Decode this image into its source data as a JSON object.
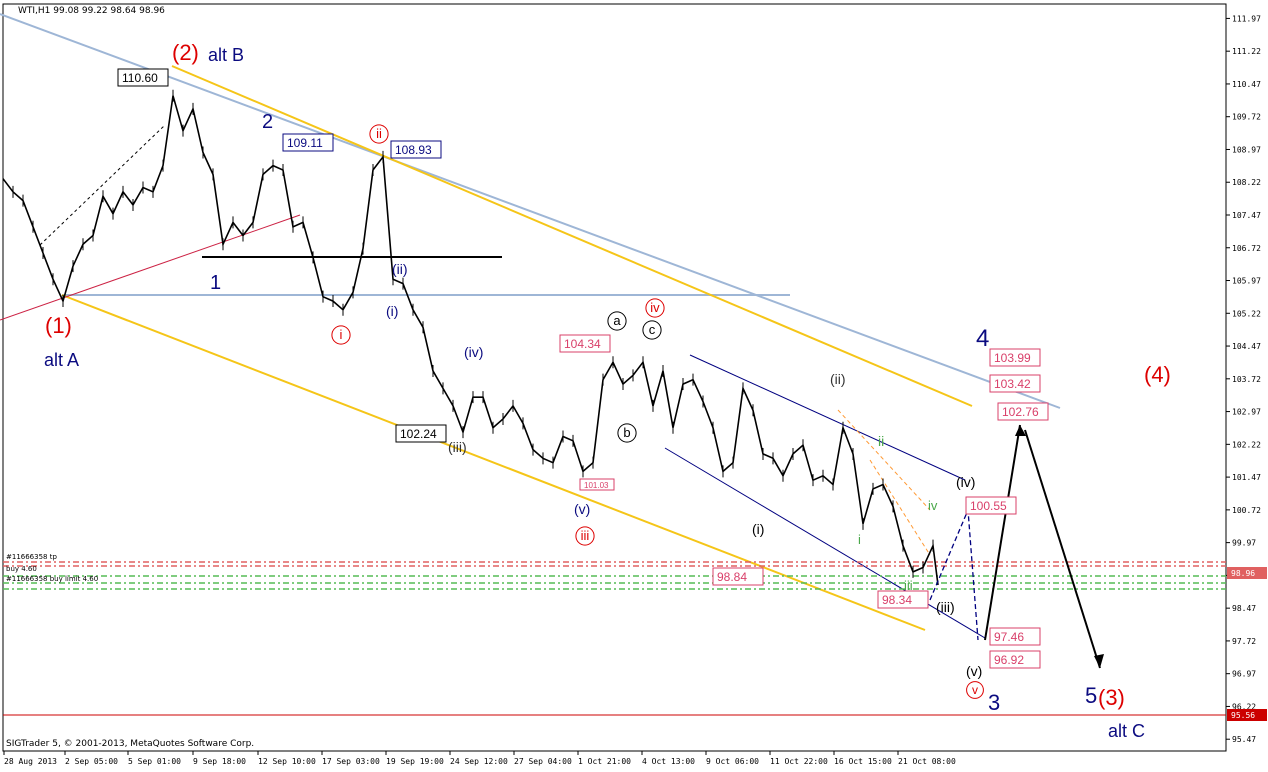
{
  "header": {
    "symbol_line": "WTI,H1  99.08 99.22 98.64 98.96"
  },
  "footer": {
    "copyright": "SIGTrader 5, © 2001-2013, MetaQuotes Software Corp."
  },
  "colors": {
    "price_line": "#000000",
    "red": "#dd0000",
    "navy": "#0b0b80",
    "gold": "#f5c518",
    "lightblue": "#9eb6d6",
    "pink": "#d9406a",
    "green_label": "#4aa84a",
    "green_dash": "#55bb55",
    "red_dash": "#e06060"
  },
  "chart_data": {
    "type": "line",
    "title": "WTI,H1",
    "ohlc_header": {
      "open": 99.08,
      "high": 99.22,
      "low": 98.64,
      "close": 98.96
    },
    "y_ticks": [
      "111.97",
      "111.22",
      "110.47",
      "109.72",
      "108.97",
      "108.22",
      "107.47",
      "106.72",
      "105.97",
      "105.22",
      "104.47",
      "103.72",
      "102.97",
      "102.22",
      "101.47",
      "100.72",
      "99.97",
      "99.22",
      "98.47",
      "97.72",
      "96.97",
      "96.22",
      "95.47"
    ],
    "ylim": [
      95.2,
      112.3
    ],
    "x_ticks": [
      "28 Aug 2013",
      "2 Sep 05:00",
      "5 Sep 01:00",
      "9 Sep 18:00",
      "12 Sep 10:00",
      "17 Sep 03:00",
      "19 Sep 19:00",
      "24 Sep 12:00",
      "27 Sep 04:00",
      "1 Oct 21:00",
      "4 Oct 13:00",
      "9 Oct 06:00",
      "11 Oct 22:00",
      "16 Oct 15:00",
      "21 Oct 08:00"
    ],
    "series": [
      {
        "points": [
          [
            0,
            108.3
          ],
          [
            10,
            108.0
          ],
          [
            20,
            107.8
          ],
          [
            30,
            107.2
          ],
          [
            40,
            106.6
          ],
          [
            50,
            106.0
          ],
          [
            60,
            105.5
          ],
          [
            70,
            106.3
          ],
          [
            80,
            106.8
          ],
          [
            90,
            107.0
          ],
          [
            100,
            107.9
          ],
          [
            110,
            107.5
          ],
          [
            120,
            108.0
          ],
          [
            130,
            107.7
          ],
          [
            140,
            108.1
          ],
          [
            150,
            108.0
          ],
          [
            160,
            108.6
          ],
          [
            170,
            110.2
          ],
          [
            180,
            109.4
          ],
          [
            190,
            109.9
          ],
          [
            200,
            108.9
          ],
          [
            210,
            108.4
          ],
          [
            220,
            106.8
          ],
          [
            230,
            107.3
          ],
          [
            240,
            107.0
          ],
          [
            250,
            107.3
          ],
          [
            260,
            108.4
          ],
          [
            270,
            108.6
          ],
          [
            280,
            108.5
          ],
          [
            290,
            107.2
          ],
          [
            300,
            107.3
          ],
          [
            310,
            106.5
          ],
          [
            320,
            105.6
          ],
          [
            330,
            105.5
          ],
          [
            340,
            105.3
          ],
          [
            350,
            105.7
          ],
          [
            360,
            106.7
          ],
          [
            370,
            108.5
          ],
          [
            380,
            108.8
          ],
          [
            390,
            106.0
          ],
          [
            400,
            105.9
          ],
          [
            410,
            105.3
          ],
          [
            420,
            104.9
          ],
          [
            430,
            103.9
          ],
          [
            440,
            103.5
          ],
          [
            450,
            103.1
          ],
          [
            460,
            102.5
          ],
          [
            470,
            103.3
          ],
          [
            480,
            103.3
          ],
          [
            490,
            102.6
          ],
          [
            500,
            102.8
          ],
          [
            510,
            103.1
          ],
          [
            520,
            102.7
          ],
          [
            530,
            102.1
          ],
          [
            540,
            101.9
          ],
          [
            550,
            101.8
          ],
          [
            560,
            102.4
          ],
          [
            570,
            102.3
          ],
          [
            580,
            101.6
          ],
          [
            590,
            101.8
          ],
          [
            600,
            103.7
          ],
          [
            610,
            104.1
          ],
          [
            620,
            103.6
          ],
          [
            630,
            103.8
          ],
          [
            640,
            104.1
          ],
          [
            650,
            103.1
          ],
          [
            660,
            103.9
          ],
          [
            670,
            102.6
          ],
          [
            680,
            103.6
          ],
          [
            690,
            103.7
          ],
          [
            700,
            103.2
          ],
          [
            710,
            102.6
          ],
          [
            720,
            101.6
          ],
          [
            730,
            101.8
          ],
          [
            740,
            103.5
          ],
          [
            750,
            103.0
          ],
          [
            760,
            102.0
          ],
          [
            770,
            101.9
          ],
          [
            780,
            101.5
          ],
          [
            790,
            102.0
          ],
          [
            800,
            102.2
          ],
          [
            810,
            101.4
          ],
          [
            820,
            101.5
          ],
          [
            830,
            101.3
          ],
          [
            840,
            102.6
          ],
          [
            850,
            102.0
          ],
          [
            860,
            100.4
          ],
          [
            870,
            101.2
          ],
          [
            880,
            101.3
          ],
          [
            890,
            100.8
          ],
          [
            900,
            99.9
          ],
          [
            910,
            99.3
          ],
          [
            920,
            99.4
          ],
          [
            930,
            99.9
          ],
          [
            935,
            99.0
          ]
        ]
      }
    ],
    "annotations": {
      "boxes": [
        {
          "text": "110.60",
          "value": 110.6
        },
        {
          "text": "109.11",
          "value": 109.11
        },
        {
          "text": "108.93",
          "value": 108.93
        },
        {
          "text": "104.34",
          "value": 104.34
        },
        {
          "text": "102.24",
          "value": 102.24
        },
        {
          "text": "101.03",
          "value": 101.03
        },
        {
          "text": "98.84",
          "value": 98.84
        },
        {
          "text": "98.34",
          "value": 98.34
        },
        {
          "text": "103.99",
          "value": 103.99
        },
        {
          "text": "103.42",
          "value": 103.42
        },
        {
          "text": "102.76",
          "value": 102.76
        },
        {
          "text": "100.55",
          "value": 100.55
        },
        {
          "text": "97.46",
          "value": 97.46
        },
        {
          "text": "96.92",
          "value": 96.92
        }
      ],
      "price_tags": [
        {
          "text": "98.96",
          "value": 98.96
        },
        {
          "text": "95.56",
          "value": 95.56
        }
      ],
      "wave_labels": [
        {
          "text": "(2)"
        },
        {
          "text": "alt B"
        },
        {
          "text": "2"
        },
        {
          "text": "1"
        },
        {
          "text": "(1)"
        },
        {
          "text": "alt A"
        },
        {
          "text": "ii"
        },
        {
          "text": "i"
        },
        {
          "text": "(ii)"
        },
        {
          "text": "(i)"
        },
        {
          "text": "(iv)"
        },
        {
          "text": "(iii)"
        },
        {
          "text": "(v)"
        },
        {
          "text": "iii"
        },
        {
          "text": "a"
        },
        {
          "text": "b"
        },
        {
          "text": "c"
        },
        {
          "text": "iv"
        },
        {
          "text": "(i)"
        },
        {
          "text": "(ii)"
        },
        {
          "text": "ii"
        },
        {
          "text": "i"
        },
        {
          "text": "iii"
        },
        {
          "text": "iv"
        },
        {
          "text": "(iii)"
        },
        {
          "text": "(iv)"
        },
        {
          "text": "(v)"
        },
        {
          "text": "v"
        },
        {
          "text": "3"
        },
        {
          "text": "4"
        },
        {
          "text": "(4)"
        },
        {
          "text": "5"
        },
        {
          "text": "(3)"
        },
        {
          "text": "alt C"
        }
      ],
      "order_lines": [
        {
          "text": "#11666358 tp"
        },
        {
          "text": "buy 4.60"
        },
        {
          "text": "#11666358 buy limit 4.60"
        }
      ]
    }
  }
}
